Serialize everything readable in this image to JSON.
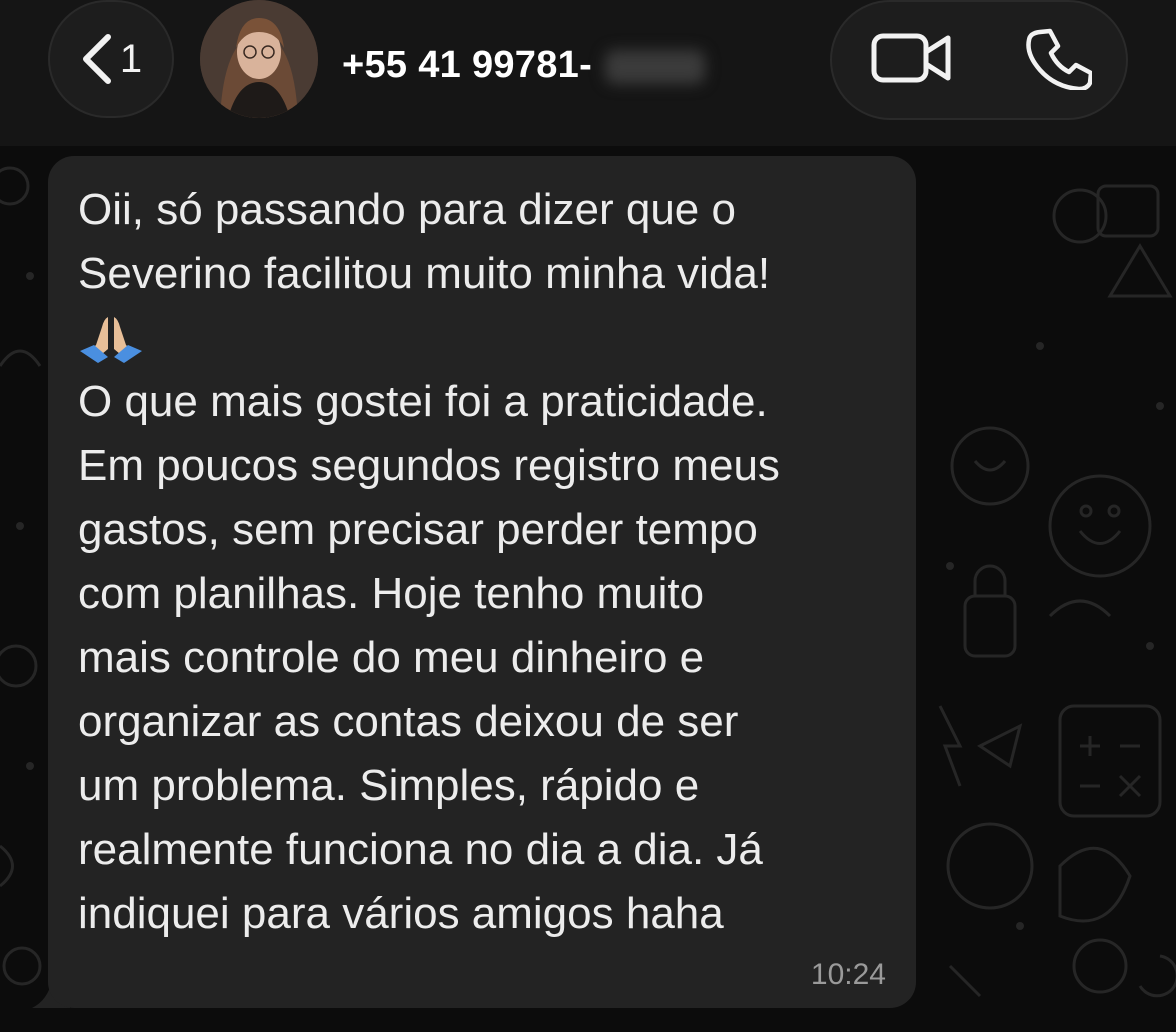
{
  "header": {
    "back_count": "1",
    "contact_name": "+55 41 99781-",
    "icons": {
      "back": "chevron-left-icon",
      "video": "video-camera-icon",
      "call": "phone-icon"
    }
  },
  "message": {
    "lines": [
      "Oii, só passando para dizer que o",
      "Severino facilitou muito minha vida!",
      "O que mais gostei foi a praticidade.",
      "Em poucos segundos registro meus",
      "gastos, sem precisar perder tempo",
      "com planilhas. Hoje tenho muito",
      "mais controle do meu dinheiro e",
      "organizar as contas deixou de ser",
      "um problema. Simples, rápido e",
      "realmente funciona no dia a dia. Já",
      "indiquei para vários amigos haha"
    ],
    "emoji": "folded-hands-emoji",
    "time": "10:24"
  },
  "colors": {
    "header_bg": "#151515",
    "bubble_bg": "#232323",
    "text": "#ececec",
    "timestamp": "#9a9a9a"
  }
}
